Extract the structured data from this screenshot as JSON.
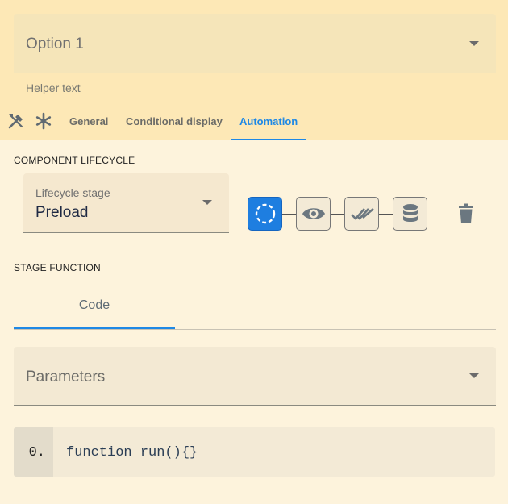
{
  "select": {
    "value": "Option 1",
    "helper": "Helper text"
  },
  "tabs": [
    {
      "label": "General",
      "active": false
    },
    {
      "label": "Conditional display",
      "active": false
    },
    {
      "label": "Automation",
      "active": true
    }
  ],
  "lifecycle": {
    "section_label": "COMPONENT LIFECYCLE",
    "field_label": "Lifecycle stage",
    "field_value": "Preload",
    "stages": [
      {
        "icon": "loading-circle-icon",
        "active": true
      },
      {
        "icon": "eye-icon",
        "active": false
      },
      {
        "icon": "double-check-icon",
        "active": false
      },
      {
        "icon": "database-icon",
        "active": false
      }
    ]
  },
  "stage_function": {
    "section_label": "STAGE FUNCTION",
    "tab_label": "Code",
    "parameters_label": "Parameters",
    "code": {
      "line_number": "0.",
      "line": "function run(){}"
    }
  },
  "colors": {
    "accent": "#1e88e5",
    "top_band": "#fde8b6",
    "background": "#fdf3dc"
  }
}
